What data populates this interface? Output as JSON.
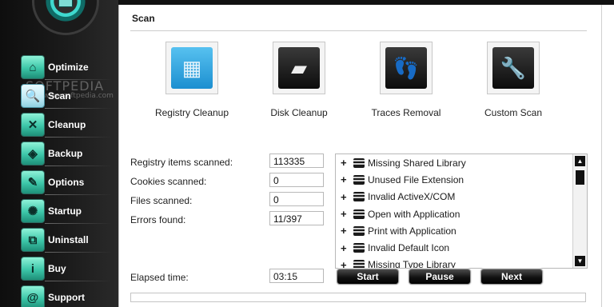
{
  "watermark": {
    "main": "SOFTPEDIA",
    "sub": "www.softpedia.com"
  },
  "sidebar": {
    "items": [
      {
        "label": "Optimize",
        "icon": "optimize-icon",
        "glyph": "⌂"
      },
      {
        "label": "Scan",
        "icon": "scan-icon",
        "glyph": "🔍",
        "active": true
      },
      {
        "label": "Cleanup",
        "icon": "cleanup-icon",
        "glyph": "✕"
      },
      {
        "label": "Backup",
        "icon": "backup-icon",
        "glyph": "◈"
      },
      {
        "label": "Options",
        "icon": "options-icon",
        "glyph": "✎"
      },
      {
        "label": "Startup",
        "icon": "startup-icon",
        "glyph": "✺"
      },
      {
        "label": "Uninstall",
        "icon": "uninstall-icon",
        "glyph": "⧉"
      },
      {
        "label": "Buy",
        "icon": "buy-icon",
        "glyph": "i"
      },
      {
        "label": "Support",
        "icon": "support-icon",
        "glyph": "@"
      }
    ]
  },
  "page": {
    "title": "Scan"
  },
  "actions": [
    {
      "label": "Registry Cleanup",
      "icon": "registry-cube-icon",
      "glyph": "▦",
      "style": "reg"
    },
    {
      "label": "Disk Cleanup",
      "icon": "hard-disk-icon",
      "glyph": "▰",
      "style": "dark"
    },
    {
      "label": "Traces Removal",
      "icon": "footprints-icon",
      "glyph": "👣",
      "style": "dark"
    },
    {
      "label": "Custom Scan",
      "icon": "wrench-icon",
      "glyph": "🔧",
      "style": "dark"
    }
  ],
  "stats": [
    {
      "label": "Registry items scanned:",
      "value": "113335"
    },
    {
      "label": "Cookies scanned:",
      "value": "0"
    },
    {
      "label": "Files scanned:",
      "value": "0"
    },
    {
      "label": "Errors found:",
      "value": "11/397"
    }
  ],
  "results": [
    "Missing Shared Library",
    "Unused File Extension",
    "Invalid ActiveX/COM",
    "Open with Application",
    "Print with Application",
    "Invalid Default Icon",
    "Missing Type Library"
  ],
  "elapsed": {
    "label": "Elapsed time:",
    "value": "03:15"
  },
  "buttons": {
    "start": "Start",
    "pause": "Pause",
    "next": "Next"
  },
  "progress": {
    "fraction": 0.0
  },
  "colors": {
    "accent": "#3cc6a8",
    "sidebar_bg": "#1c1c1c"
  }
}
